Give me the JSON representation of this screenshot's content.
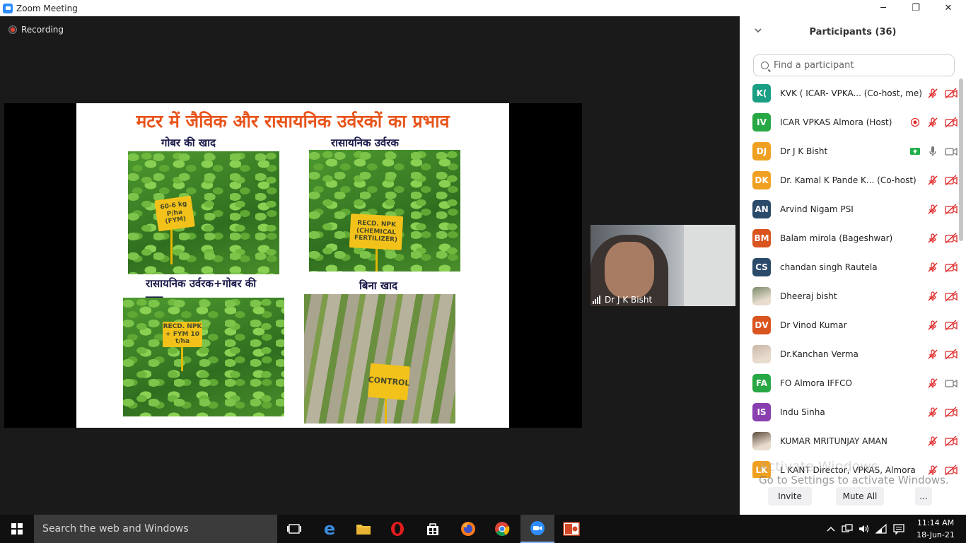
{
  "window": {
    "title": "Zoom Meeting",
    "minimize": "─",
    "maximize": "❐",
    "close": "✕"
  },
  "meeting": {
    "recording_label": "Recording",
    "video_tile_name": "Dr J K Bisht"
  },
  "slide": {
    "title": "मटर में जैविक और रासायनिक उर्वरकों का प्रभाव",
    "captions": [
      "गोबर की खाद",
      "रासायनिक उर्वरक",
      "रासायनिक उर्वरक+गोबर की खाद",
      "बिना खाद"
    ],
    "signs": [
      "60-6 kg P/ha (FYM)",
      "RECD. NPK (CHEMICAL FERTILIZER)",
      "RECD. NPK + FYM 10 t/ha",
      "CONTROL"
    ]
  },
  "participants_panel": {
    "header": "Participants (36)",
    "search_placeholder": "Find a participant",
    "participants": [
      {
        "initials": "K(",
        "name": "KVK ( ICAR- VPKA... (Co-host, me)",
        "color": "#1a9e84",
        "mic": "muted",
        "cam": "off"
      },
      {
        "initials": "IV",
        "name": "ICAR VPKAS Almora (Host)",
        "color": "#27a844",
        "mic": "muted",
        "cam": "off",
        "recording": true
      },
      {
        "initials": "DJ",
        "name": "Dr J K Bisht",
        "color": "#f0a020",
        "mic": "on",
        "cam": "on",
        "share": true
      },
      {
        "initials": "DK",
        "name": "Dr. Kamal K Pande K...  (Co-host)",
        "color": "#f0a020",
        "mic": "muted",
        "cam": "off"
      },
      {
        "initials": "AN",
        "name": "Arvind Nigam PSI",
        "color": "#2a4a6a",
        "mic": "muted",
        "cam": "off"
      },
      {
        "initials": "BM",
        "name": "Balam mirola (Bageshwar)",
        "color": "#d9541e",
        "mic": "muted",
        "cam": "off"
      },
      {
        "initials": "CS",
        "name": "chandan singh Rautela",
        "color": "#2a4a6a",
        "mic": "muted",
        "cam": "off"
      },
      {
        "initials": "",
        "name": "Dheeraj bisht",
        "color": "#7a8a6a",
        "mic": "muted",
        "cam": "off",
        "photo": true
      },
      {
        "initials": "DV",
        "name": "Dr Vinod Kumar",
        "color": "#d9541e",
        "mic": "muted",
        "cam": "off"
      },
      {
        "initials": "",
        "name": "Dr.Kanchan Verma",
        "color": "#c9b6a6",
        "mic": "muted",
        "cam": "off",
        "photo": true
      },
      {
        "initials": "FA",
        "name": "FO Almora IFFCO",
        "color": "#27a844",
        "mic": "muted",
        "cam": "on"
      },
      {
        "initials": "IS",
        "name": "Indu Sinha",
        "color": "#8a3fb0",
        "mic": "muted",
        "cam": "off"
      },
      {
        "initials": "",
        "name": "KUMAR MRITUNJAY AMAN",
        "color": "#5a4a3a",
        "mic": "muted",
        "cam": "off",
        "photo": true
      },
      {
        "initials": "LK",
        "name": "L KANT Director, VPKAS, Almora",
        "color": "#f0a020",
        "mic": "muted",
        "cam": "off"
      }
    ],
    "invite_label": "Invite",
    "mute_all_label": "Mute All",
    "more_label": "..."
  },
  "watermark": {
    "line1": "Activate Windows",
    "line2": "Go to Settings to activate Windows."
  },
  "taskbar": {
    "search_placeholder": "Search the web and Windows",
    "time": "11:14 AM",
    "date": "18-Jun-21"
  },
  "colors": {
    "muted_red": "#e02828",
    "zoom_blue": "#2d8cff",
    "slide_title_orange": "#e8541a"
  }
}
